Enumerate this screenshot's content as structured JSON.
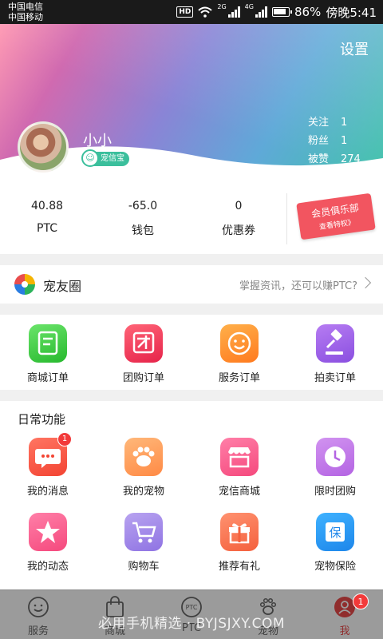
{
  "status_bar": {
    "carrier_1": "中国电信",
    "carrier_2": "中国移动",
    "hd": "HD",
    "net_1": "2G",
    "net_2": "4G",
    "battery": "86%",
    "time": "傍晚5:41"
  },
  "header": {
    "settings_label": "设置",
    "username": "小小",
    "badge": "宠信宝",
    "stats": [
      {
        "label": "关注",
        "value": "1"
      },
      {
        "label": "粉丝",
        "value": "1"
      },
      {
        "label": "被赞",
        "value": "274"
      }
    ]
  },
  "wallet": {
    "items": [
      {
        "value": "40.88",
        "label": "PTC"
      },
      {
        "value": "-65.0",
        "label": "钱包"
      },
      {
        "value": "0",
        "label": "优惠券"
      }
    ],
    "club_title": "会员俱乐部",
    "club_sub": "查看特权》"
  },
  "circle": {
    "title": "宠友圈",
    "hint": "掌握资讯，还可以赚PTC?"
  },
  "orders": [
    {
      "label": "商城订单",
      "icon": "document-icon"
    },
    {
      "label": "团购订单",
      "icon": "group-buy-icon"
    },
    {
      "label": "服务订单",
      "icon": "smile-icon"
    },
    {
      "label": "拍卖订单",
      "icon": "gavel-icon"
    }
  ],
  "daily": {
    "title": "日常功能",
    "items": [
      {
        "label": "我的消息",
        "icon": "message-icon",
        "badge": "1"
      },
      {
        "label": "我的宠物",
        "icon": "paw-icon"
      },
      {
        "label": "宠信商城",
        "icon": "shop-icon"
      },
      {
        "label": "限时团购",
        "icon": "clock-icon"
      },
      {
        "label": "我的动态",
        "icon": "star-icon"
      },
      {
        "label": "购物车",
        "icon": "cart-icon"
      },
      {
        "label": "推荐有礼",
        "icon": "gift-icon"
      },
      {
        "label": "宠物保险",
        "icon": "insurance-icon"
      }
    ]
  },
  "bottom_nav": {
    "tabs": [
      {
        "label": "服务",
        "icon": "smile-face-icon"
      },
      {
        "label": "商城",
        "icon": "shopping-bag-icon"
      },
      {
        "label": "PTC",
        "icon": "ptc-coin-icon"
      },
      {
        "label": "宠物",
        "icon": "paw-print-icon"
      },
      {
        "label": "我",
        "icon": "person-icon",
        "active": true
      }
    ],
    "me_badge": "1",
    "watermark": "必用手机精选 · BYJSJXY.COM"
  }
}
